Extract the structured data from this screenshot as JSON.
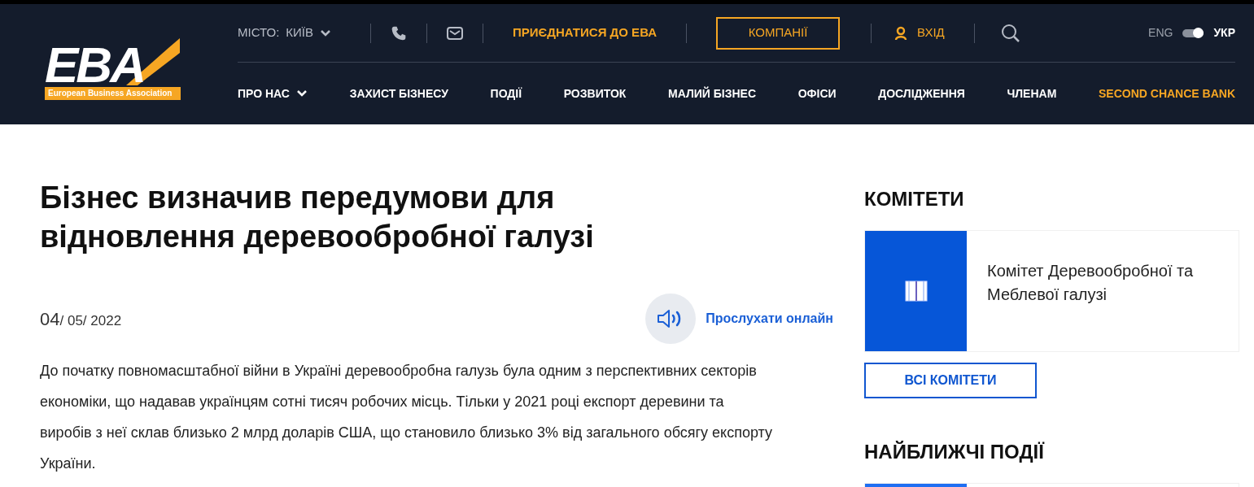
{
  "logo": {
    "mark": "EBA",
    "tagline": "European Business Association"
  },
  "top_bar": {
    "city_label": "МІСТО:",
    "city": "КИЇВ",
    "join_link": "ПРИЄДНАТИСЯ ДО ЕВА",
    "companies_button": "КОМПАНІЇ",
    "login": "ВХІД",
    "languages": [
      {
        "label": "ENG",
        "selected": false
      },
      {
        "label": "УКР",
        "selected": true
      }
    ]
  },
  "nav": [
    {
      "label": "ПРО НАС",
      "expandable": true,
      "color": "#ffffff"
    },
    {
      "label": "ЗАХИСТ БІЗНЕСУ",
      "expandable": false,
      "color": "#ffffff"
    },
    {
      "label": "ПОДІЇ",
      "expandable": false,
      "color": "#ffffff"
    },
    {
      "label": "РОЗВИТОК",
      "expandable": false,
      "color": "#ffffff"
    },
    {
      "label": "МАЛИЙ БІЗНЕС",
      "expandable": false,
      "color": "#ffffff"
    },
    {
      "label": "ОФІСИ",
      "expandable": false,
      "color": "#ffffff"
    },
    {
      "label": "ДОСЛІДЖЕННЯ",
      "expandable": false,
      "color": "#ffffff"
    },
    {
      "label": "ЧЛЕНАМ",
      "expandable": false,
      "color": "#ffffff"
    },
    {
      "label": "SECOND CHANCE BANK",
      "expandable": false,
      "color": "#f6a623"
    }
  ],
  "article": {
    "title": "Бізнес визначив передумови для відновлення деревообробної галузі",
    "date_day": "04",
    "date_rest": "/ 05/ 2022",
    "listen_button": "Прослухати онлайн",
    "paragraph": "До початку повномасштабної війни в Україні деревообробна галузь була одним з перспективних секторів економіки, що надавав українцям сотні тисяч робочих місць. Тільки у 2021 році експорт деревини та виробів з неї склав близько 2 млрд доларів США, що становило близько 3% від загального обсягу експорту України."
  },
  "sidebar": {
    "committees_heading": "КОМІТЕТИ",
    "committee": "Комітет Деревообробної та Меблевої галузі",
    "all_committees_button": "ВСІ КОМІТЕТИ",
    "events_heading": "НАЙБЛИЖЧІ ПОДІЇ"
  }
}
